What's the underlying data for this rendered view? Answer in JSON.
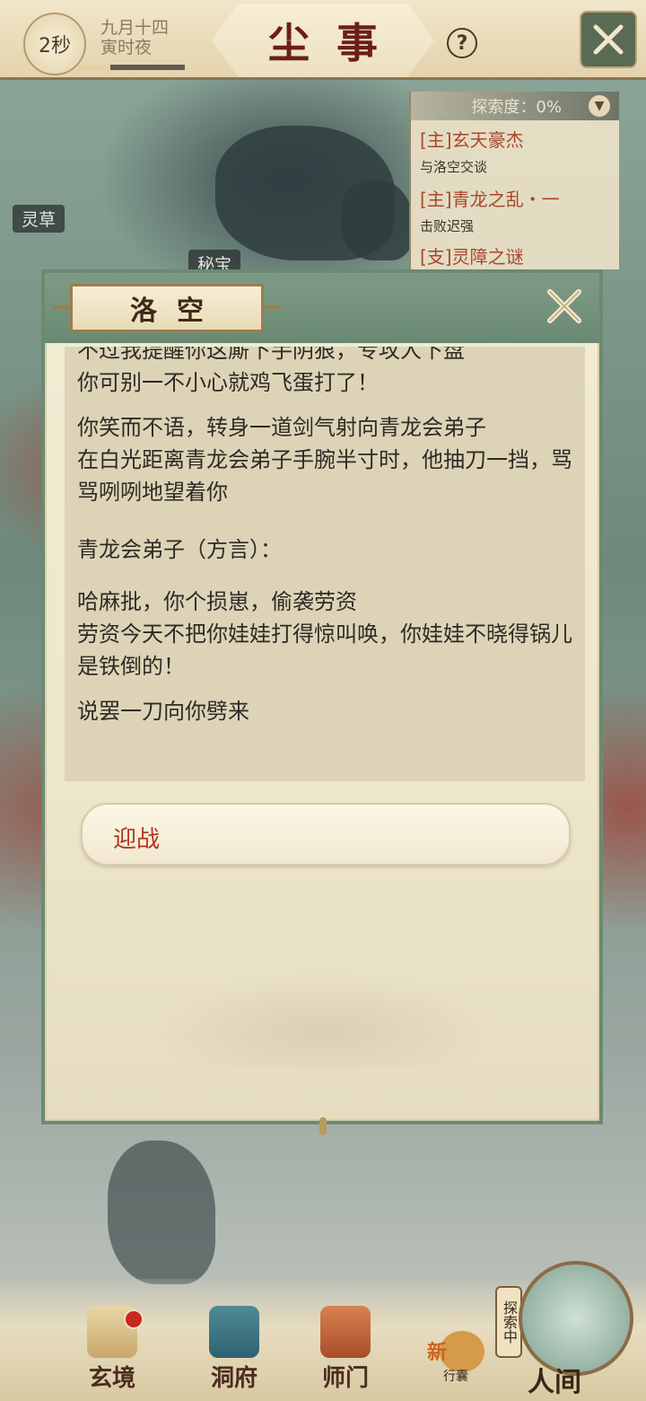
{
  "top_bar": {
    "timer": "2秒",
    "date_line1": "九月十四",
    "date_line2": "寅时夜",
    "progress": 0.3,
    "title": "尘事",
    "help_label": "?"
  },
  "quest_panel": {
    "explore_label": "探索度：0%",
    "quests": [
      {
        "title": "[主]玄天豪杰",
        "desc": "与洛空交谈"
      },
      {
        "title": "[主]青龙之乱・一",
        "desc": "击败迟强"
      },
      {
        "title": "[支]灵障之谜",
        "desc": ""
      }
    ]
  },
  "map_labels": {
    "herb": "灵草",
    "treasure": "秘宝"
  },
  "dialog": {
    "speaker": "洛空",
    "paragraphs": [
      "不过我提醒你这厮下手阴狠，专攻人下盘\n你可别一不小心就鸡飞蛋打了！",
      "你笑而不语，转身一道剑气射向青龙会弟子\n在白光距离青龙会弟子手腕半寸时，他抽刀一挡，骂骂咧咧地望着你",
      "青龙会弟子（方言）：",
      "哈麻批，你个损崽，偷袭劳资\n劳资今天不把你娃娃打得惊叫唤，你娃娃不晓得锅儿是铁倒的！",
      "说罢一刀向你劈来"
    ],
    "option": "迎战"
  },
  "bottom_nav": {
    "items": [
      {
        "label": "玄境",
        "icon": "scroll-icon"
      },
      {
        "label": "洞府",
        "icon": "pavilion-icon"
      },
      {
        "label": "师门",
        "icon": "banner-icon"
      }
    ],
    "bag_new": "新",
    "bag_label": "行囊",
    "explore_tag": "探索中",
    "realm_label": "人间"
  },
  "colors": {
    "accent_red": "#b2341f",
    "quest_text": "#a8472e",
    "dialog_green": "#6a8973"
  }
}
